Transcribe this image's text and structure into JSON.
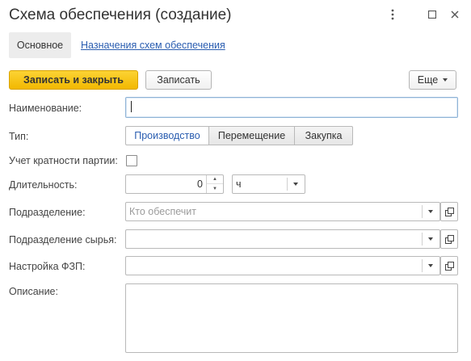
{
  "window": {
    "title": "Схема обеспечения (создание)"
  },
  "tabs": {
    "main": "Основное",
    "link": "Назначения схем обеспечения"
  },
  "toolbar": {
    "save_close": "Записать и закрыть",
    "save": "Записать",
    "more": "Еще"
  },
  "form": {
    "name_label": "Наименование:",
    "name_value": "",
    "type_label": "Тип:",
    "type_options": [
      "Производство",
      "Перемещение",
      "Закупка"
    ],
    "type_selected": "Производство",
    "batch_label": "Учет кратности партии:",
    "batch_checked": false,
    "duration_label": "Длительность:",
    "duration_value": "0",
    "duration_unit": "ч",
    "division_label": "Подразделение:",
    "division_placeholder": "Кто обеспечит",
    "raw_division_label": "Подразделение сырья:",
    "raw_division_value": "",
    "fzp_label": "Настройка ФЗП:",
    "fzp_value": "",
    "description_label": "Описание:",
    "description_value": ""
  },
  "colors": {
    "accent": "#f2b800",
    "link": "#2a5db0"
  }
}
